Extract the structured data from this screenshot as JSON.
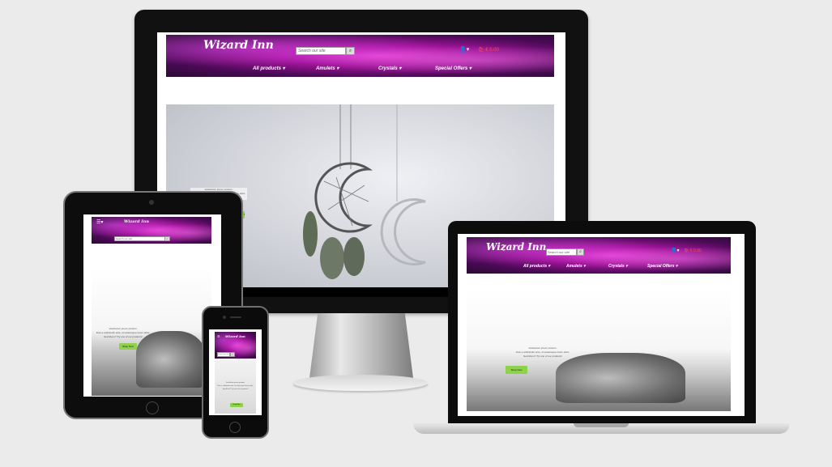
{
  "site": {
    "logo": "Wizard Inn",
    "search_placeholder": "Search our site",
    "search_icon": "search-icon",
    "account_icon": "user-icon",
    "cart_icon": "cart-icon",
    "cart_total": "€ 0.00",
    "nav": [
      "All products ▾",
      "Amulets ▾",
      "Crystals ▾",
      "Special Offers ▾"
    ]
  },
  "hero": {
    "line1": "Vestibulum ipsum pretium.",
    "line2": "Duis a sollicitudin ante, id scelerisque lorem dolor.",
    "line3": "Sed libero? Try one of our products!",
    "button": "Shop Now"
  },
  "colors": {
    "accent_button": "#8ed14a",
    "header": "#a0149a",
    "cart": "#ff4b4b"
  }
}
